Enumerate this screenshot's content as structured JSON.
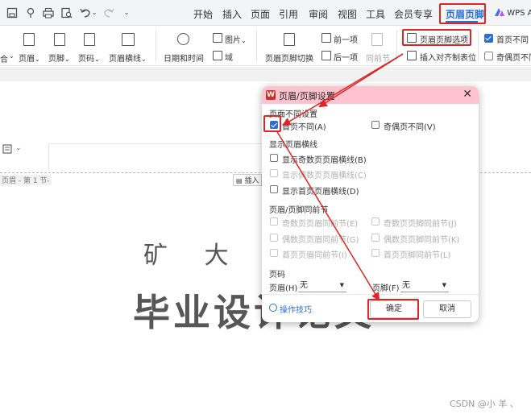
{
  "menu": {
    "tabs": [
      "开始",
      "插入",
      "页面",
      "引用",
      "审阅",
      "视图",
      "工具",
      "会员专享"
    ],
    "active_tab": "页眉页脚",
    "wps_ai": "WPS A"
  },
  "quick_access": {
    "icons": [
      "save-icon",
      "format-painter-icon",
      "print-icon",
      "print-preview-icon",
      "undo-icon",
      "redo-icon",
      "more-icon"
    ],
    "undo_caret": "⌄",
    "more": "⌄"
  },
  "ribbon": {
    "partial_left": "合",
    "header_btn": "页眉",
    "footer_btn": "页脚",
    "pagenum_btn": "页码",
    "header_line_btn": "页眉横线",
    "datetime_btn": "日期和时间",
    "image_btn": "图片",
    "field_btn": "域",
    "switch_btn": "页眉页脚切换",
    "prev_btn": "前一项",
    "next_btn": "后一项",
    "same_btn": "同前节",
    "options_btn": "页眉页脚选项",
    "align_tab_btn": "插入对齐制表位",
    "first_page_diff": "首页不同",
    "odd_even_diff": "奇偶页不同",
    "caret": "⌄"
  },
  "document": {
    "header_label": "页眉 - 第 1 节-",
    "insert_btn": "插入",
    "text1": "矿 大 文",
    "text2": "毕业设计论文",
    "watermark": "CSDN @小 羊 、"
  },
  "dialog": {
    "title": "页眉/页脚设置",
    "logo": "W",
    "close": "✕",
    "section1": "页面不同设置",
    "first_page_diff": "首页不同(A)",
    "odd_even_diff": "奇偶页不同(V)",
    "section2": "显示页眉横线",
    "show_odd_line": "显示奇数页页眉横线(B)",
    "show_even_line": "显示偶数页页眉横线(C)",
    "show_first_line": "显示首页页眉横线(D)",
    "section3": "页眉/页脚同前节",
    "odd_header_same": "奇数页页眉同前节(E)",
    "odd_footer_same": "奇数页页脚同前节(J)",
    "even_header_same": "偶数页页眉同前节(G)",
    "even_footer_same": "偶数页页脚同前节(K)",
    "first_header_same": "首页页眉同前节(I)",
    "first_footer_same": "首页页脚同前节(L)",
    "section4": "页码",
    "header_label": "页眉(H)",
    "header_value": "无",
    "footer_label": "页脚(F)",
    "footer_value": "无",
    "tips": "操作技巧",
    "ok": "确定",
    "cancel": "取消",
    "caret": "▼"
  },
  "colors": {
    "accent": "#2b6fd6",
    "annotation_red": "#e02424",
    "dialog_title_bg": "#ffc3d0"
  }
}
